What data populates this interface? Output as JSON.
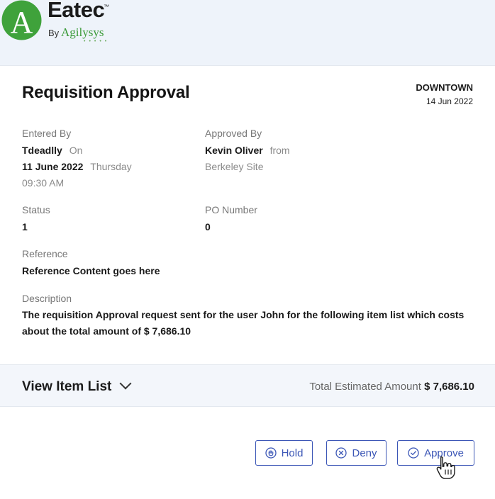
{
  "header": {
    "brand": "Eatec",
    "trademark": "™",
    "by": "By",
    "company": "Agilysys",
    "logo_letter": "A"
  },
  "card": {
    "title": "Requisition Approval",
    "location": "DOWNTOWN",
    "location_date": "14 Jun 2022"
  },
  "entered": {
    "label": "Entered By",
    "user": "Tdeadlly",
    "on_text": "On",
    "date": "11 June 2022",
    "weekday": "Thursday",
    "time": "09:30 AM"
  },
  "approved": {
    "label": "Approved By",
    "user": "Kevin Oliver",
    "from_text": "from",
    "site": "Berkeley Site"
  },
  "status": {
    "label": "Status",
    "value": "1"
  },
  "po": {
    "label": "PO Number",
    "value": "0"
  },
  "reference": {
    "label": "Reference",
    "value": "Reference Content goes here"
  },
  "description": {
    "label": "Description",
    "text": "The requisition Approval request sent for the user John for the following item list which costs about the total amount of $ 7,686.10"
  },
  "items": {
    "view_label": "View Item List",
    "total_label": "Total Estimated Amount",
    "total_value": "$ 7,686.10"
  },
  "actions": {
    "hold": "Hold",
    "deny": "Deny",
    "approve": "Approve"
  },
  "colors": {
    "accent": "#3b56b6",
    "brand_green": "#3a9a38",
    "background": "#f3f6fb"
  }
}
